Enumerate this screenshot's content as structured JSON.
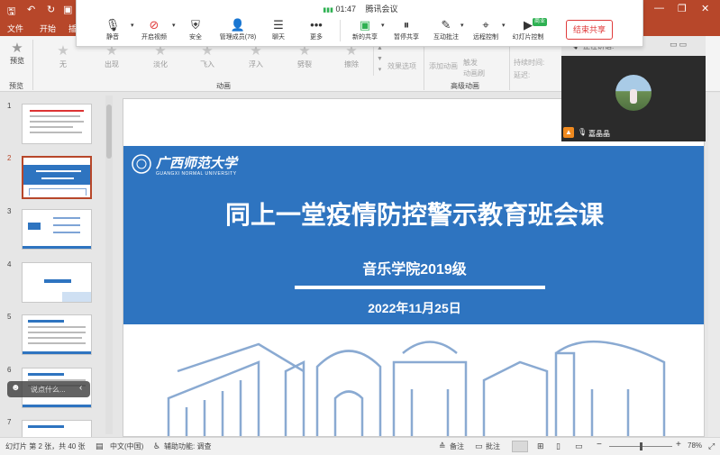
{
  "menu": {
    "file": "文件",
    "home": "开始",
    "insert": "插"
  },
  "ribbon": {
    "preview_label": "预览",
    "preview_group": "预览",
    "animations": [
      {
        "label": "无",
        "icon": "star-icon"
      },
      {
        "label": "出现",
        "icon": "star-icon"
      },
      {
        "label": "淡化",
        "icon": "star-icon"
      },
      {
        "label": "飞入",
        "icon": "star-icon"
      },
      {
        "label": "浮入",
        "icon": "star-icon"
      },
      {
        "label": "劈裂",
        "icon": "star-icon"
      },
      {
        "label": "擦除",
        "icon": "star-icon"
      }
    ],
    "animation_group": "动画",
    "effect_options": "效果选项",
    "add_animation": "添加动画",
    "trigger": "触发",
    "animation_painter": "动画刷",
    "advanced_group": "高级动画",
    "duration": "持续时间:",
    "delay": "延迟:"
  },
  "meeting": {
    "time": "01:47",
    "app_name": "腾讯会议",
    "buttons": [
      {
        "label": "静音",
        "icon": "microphone-icon"
      },
      {
        "label": "开启视频",
        "icon": "camera-off-icon"
      },
      {
        "label": "安全",
        "icon": "shield-icon"
      },
      {
        "label": "管理成员(78)",
        "icon": "members-icon"
      },
      {
        "label": "聊天",
        "icon": "chat-icon"
      },
      {
        "label": "更多",
        "icon": "more-icon"
      },
      {
        "label": "新的共享",
        "icon": "share-icon"
      },
      {
        "label": "暂停共享",
        "icon": "pause-icon"
      },
      {
        "label": "互动批注",
        "icon": "annotate-icon"
      },
      {
        "label": "远程控制",
        "icon": "remote-control-icon"
      },
      {
        "label": "幻灯片控制",
        "icon": "slide-control-icon"
      }
    ],
    "new_badge": "商业",
    "end_share": "结束共享",
    "speaking": "正在讲话:",
    "participant_name": "嘉晶晶"
  },
  "slides": {
    "numbers": [
      "1",
      "2",
      "3",
      "4",
      "5",
      "6",
      "7"
    ],
    "current": 2
  },
  "slide": {
    "university_cn": "广西师范大学",
    "university_en": "GUANGXI NORMAL UNIVERSITY",
    "title": "同上一堂疫情防控警示教育班会课",
    "subtitle": "音乐学院2019级",
    "date": "2022年11月25日"
  },
  "comment": {
    "placeholder": "说点什么..."
  },
  "status": {
    "slide_info": "幻灯片 第 2 张，共 40 张",
    "language": "中文(中国)",
    "accessibility": "辅助功能: 调查",
    "notes": "备注",
    "comments": "批注",
    "zoom": "78%"
  },
  "colors": {
    "brand": "#b7472a",
    "slide_blue": "#2e74c0",
    "end_share_red": "#e03b3b"
  }
}
